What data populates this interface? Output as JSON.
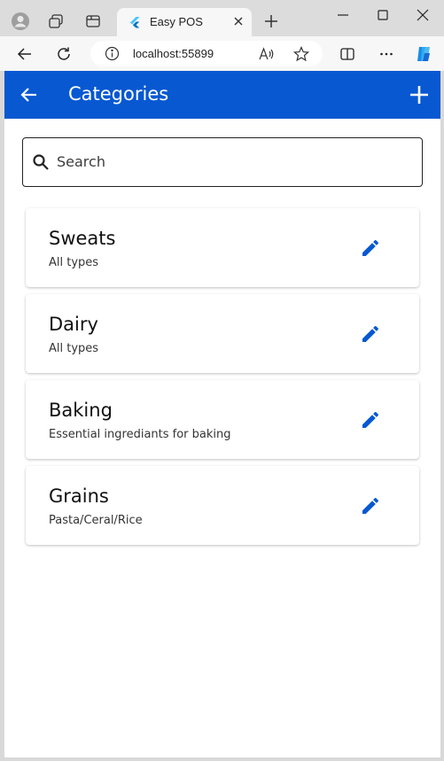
{
  "browser": {
    "tab_title": "Easy POS",
    "url": "localhost:55899"
  },
  "app": {
    "title": "Categories",
    "accent_color": "#0758d1",
    "search_placeholder": "Search"
  },
  "categories": [
    {
      "name": "Sweats",
      "description": "All types"
    },
    {
      "name": "Dairy",
      "description": "All types"
    },
    {
      "name": "Baking",
      "description": "Essential ingrediants for baking"
    },
    {
      "name": "Grains",
      "description": "Pasta/Ceral/Rice"
    }
  ],
  "icons": {
    "back": "arrow-left-icon",
    "add": "plus-icon",
    "search": "search-icon",
    "edit": "pencil-icon"
  }
}
